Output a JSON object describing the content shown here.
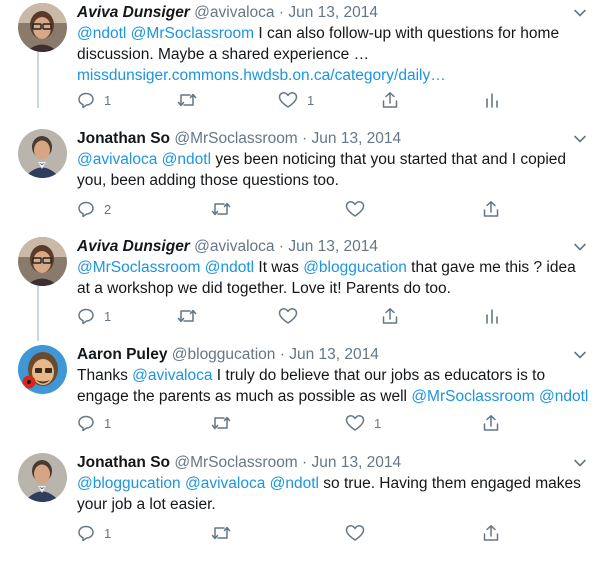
{
  "tweets": [
    {
      "name": "Aviva Dunsiger",
      "handle": "@avivaloca",
      "sep": "·",
      "date": "Jun 13, 2014",
      "text": {
        "m1": "@ndotl",
        "m2": "@MrSoclassroom",
        "t1": " I can also follow-up with questions for home discussion. Maybe a shared experience …",
        "link": "missdunsiger.commons.hwdsb.on.ca/category/daily…"
      },
      "reply_count": "1",
      "like_count": "1"
    },
    {
      "name": "Jonathan So",
      "handle": "@MrSoclassroom",
      "sep": "·",
      "date": "Jun 13, 2014",
      "text": {
        "m1": "@avivaloca",
        "m2": "@ndotl",
        "t1": " yes been noticing that you started that and I copied you, been adding those questions too."
      },
      "reply_count": "2"
    },
    {
      "name": "Aviva Dunsiger",
      "handle": "@avivaloca",
      "sep": "·",
      "date": "Jun 13, 2014",
      "text": {
        "m1": "@MrSoclassroom",
        "m2": "@ndotl",
        "t1": " It was ",
        "m3": "@bloggucation",
        "t2": " that gave me this ? idea at a workshop we did together. Love it! Parents do too."
      },
      "reply_count": "1"
    },
    {
      "name": "Aaron Puley",
      "handle": "@bloggucation",
      "sep": "·",
      "date": "Jun 13, 2014",
      "text": {
        "t0": "Thanks ",
        "m1": "@avivaloca",
        "t1": " I truly do believe that our jobs as educators is to engage the parents as much as possible as well ",
        "m2": "@MrSoclassroom",
        "m3": "@ndotl"
      },
      "reply_count": "1",
      "like_count": "1"
    },
    {
      "name": "Jonathan So",
      "handle": "@MrSoclassroom",
      "sep": "·",
      "date": "Jun 13, 2014",
      "text": {
        "m1": "@bloggucation",
        "m2": "@avivaloca",
        "m3": "@ndotl",
        "t1": " so true. Having them engaged makes your job a lot easier."
      },
      "reply_count": "1"
    }
  ],
  "icons": {
    "reply": "reply-icon",
    "retweet": "retweet-icon",
    "like": "like-icon",
    "share": "share-icon",
    "analytics": "analytics-icon",
    "more": "chevron-down-icon"
  },
  "colors": {
    "link": "#1b95e0",
    "secondary": "#657786",
    "thread_line": "#ccd6dd"
  }
}
